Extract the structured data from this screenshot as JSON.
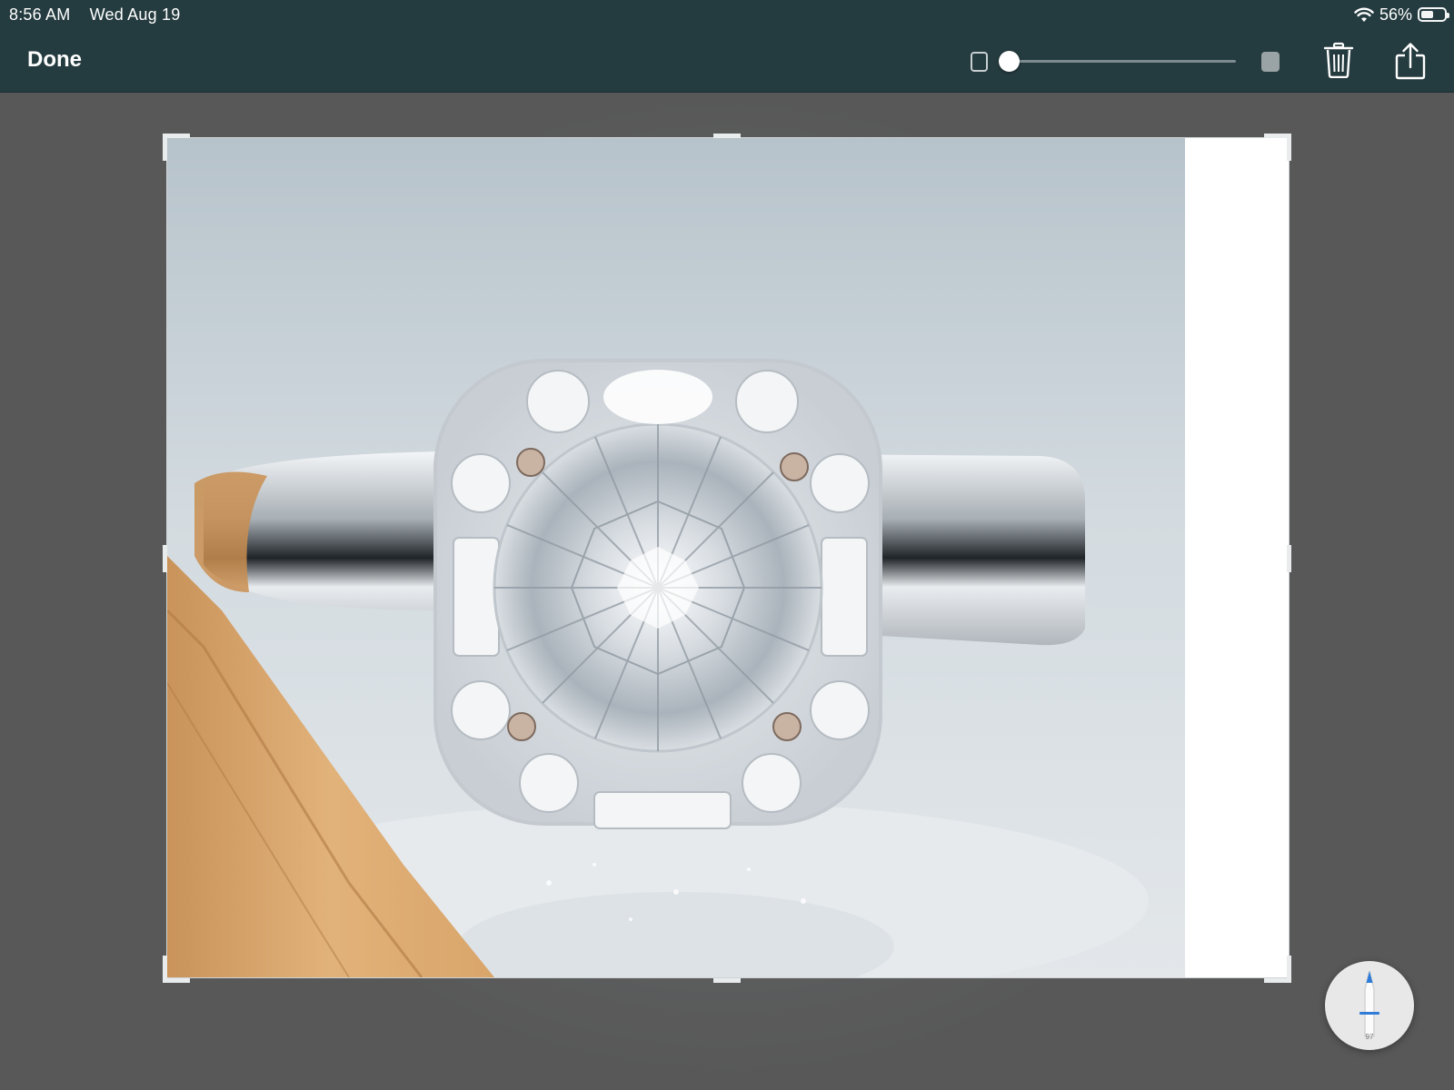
{
  "status_bar": {
    "time": "8:56 AM",
    "date": "Wed Aug 19",
    "battery_percent_label": "56%",
    "battery_level": 0.56,
    "icons": [
      "wifi-icon",
      "battery-icon"
    ]
  },
  "toolbar": {
    "done_label": "Done",
    "stroke_size": {
      "min_icon": "small-square-icon",
      "max_icon": "large-square-icon",
      "value": 0.0
    },
    "icons": [
      "trash-icon",
      "share-icon"
    ]
  },
  "canvas": {
    "background_color": "#585858",
    "image_subject": "photo"
  },
  "pencil_tool": {
    "icon": "pencil-icon",
    "accent_color": "#2f7bd8",
    "value": "97"
  },
  "colors": {
    "toolbar": "#243b3f",
    "canvas": "#585858",
    "accent": "#2f7bd8"
  }
}
